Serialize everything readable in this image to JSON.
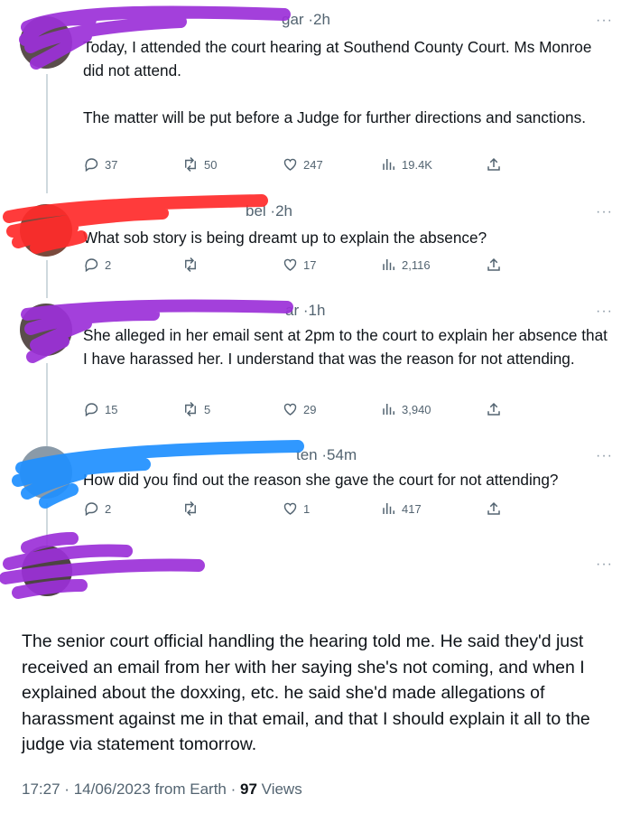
{
  "replies": [
    {
      "header_handle": "gar",
      "time": "2h",
      "paragraphs": [
        "Today, I attended the court hearing at Southend County Court. Ms Monroe did not attend.",
        "The matter will be put before a Judge for further directions and sanctions."
      ],
      "replies": "37",
      "retweets": "50",
      "likes": "247",
      "views": "19.4K"
    },
    {
      "header_handle": "bel",
      "time": "2h",
      "paragraphs": [
        "What sob story is being dreamt up to explain the absence?"
      ],
      "replies": "2",
      "retweets": "",
      "likes": "17",
      "views": "2,116"
    },
    {
      "header_handle": "ar",
      "time": "1h",
      "paragraphs": [
        "She alleged in her email sent at 2pm to the court to explain her absence that I have harassed her. I understand that was the reason for not attending."
      ],
      "replies": "15",
      "retweets": "5",
      "likes": "29",
      "views": "3,940"
    },
    {
      "header_handle": "ten",
      "time": "54m",
      "paragraphs": [
        "How did you find out the reason she gave the court for not attending?"
      ],
      "replies": "2",
      "retweets": "",
      "likes": "1",
      "views": "417"
    }
  ],
  "main_tweet": {
    "text": "The senior court official handling the hearing told me. He said they'd just received an email from her with her saying she's not coming, and when I explained about the doxxing, etc. he said she'd made allegations of harassment against me in that email, and that I should explain it all to the judge via statement tomorrow.",
    "time": "17:27",
    "date": "14/06/2023",
    "source": "from Earth",
    "views_count": "97",
    "views_label": "Views"
  },
  "more_symbol": "···",
  "separator": "·",
  "icons": [
    "reply-icon",
    "retweet-icon",
    "like-icon",
    "views-icon",
    "share-icon",
    "more-icon"
  ],
  "colors": {
    "text": "#0f1419",
    "secondary": "#536471",
    "redaction_purple": "#9b30d8",
    "redaction_red": "#ff2a2a",
    "redaction_blue": "#1e8fff"
  }
}
